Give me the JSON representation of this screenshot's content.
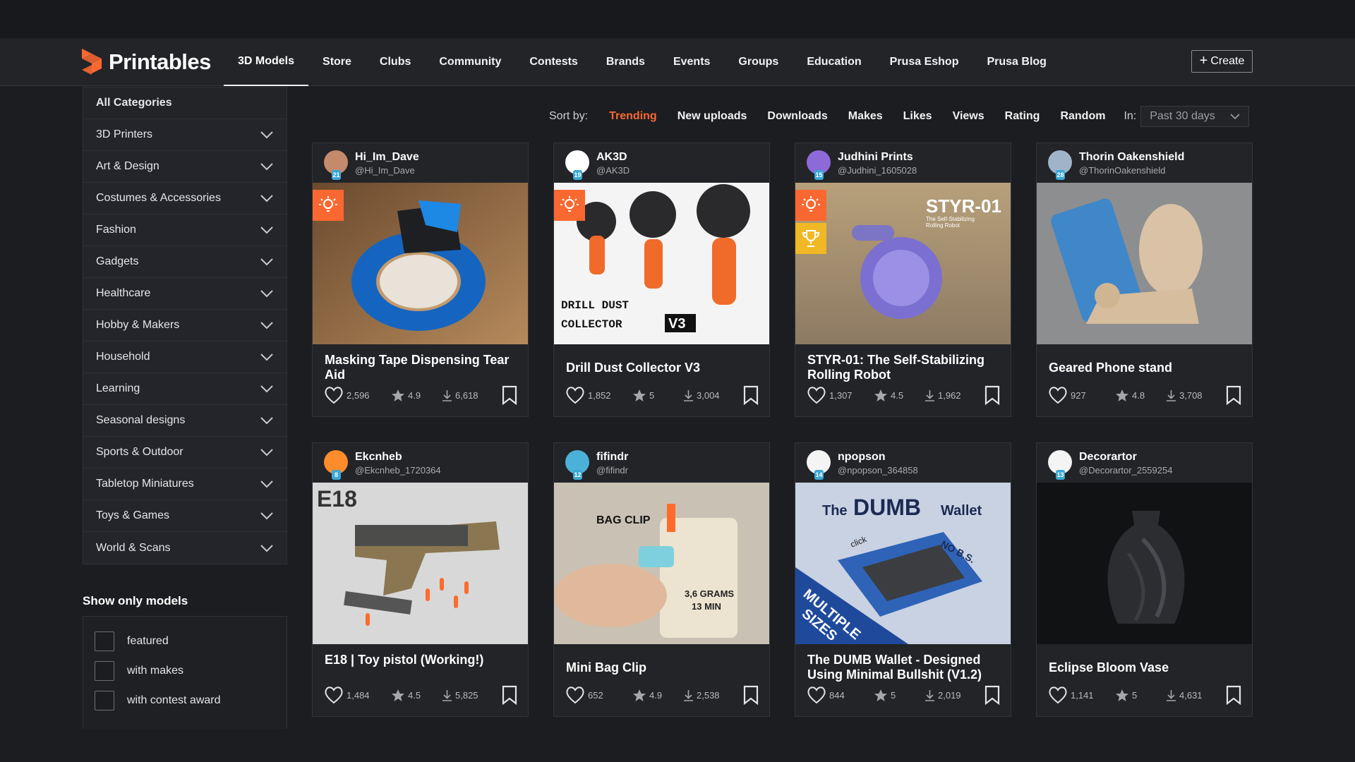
{
  "brand": {
    "name": "Printables",
    "accent": "#fa6831"
  },
  "nav": [
    {
      "label": "3D Models",
      "active": true
    },
    {
      "label": "Store"
    },
    {
      "label": "Clubs"
    },
    {
      "label": "Community"
    },
    {
      "label": "Contests"
    },
    {
      "label": "Brands"
    },
    {
      "label": "Events"
    },
    {
      "label": "Groups"
    },
    {
      "label": "Education"
    },
    {
      "label": "Prusa Eshop"
    },
    {
      "label": "Prusa Blog"
    }
  ],
  "create_label": "Create",
  "sidebar": {
    "all_label": "All Categories",
    "categories": [
      "3D Printers",
      "Art & Design",
      "Costumes & Accessories",
      "Fashion",
      "Gadgets",
      "Healthcare",
      "Hobby & Makers",
      "Household",
      "Learning",
      "Seasonal designs",
      "Sports & Outdoor",
      "Tabletop Miniatures",
      "Toys & Games",
      "World & Scans"
    ],
    "show_only_title": "Show only models",
    "filters": [
      "featured",
      "with makes",
      "with contest award"
    ]
  },
  "sort": {
    "label": "Sort by:",
    "options": [
      "Trending",
      "New uploads",
      "Downloads",
      "Makes",
      "Likes",
      "Views",
      "Rating",
      "Random"
    ],
    "active": "Trending",
    "in_label": "In:",
    "period": "Past 30 days"
  },
  "models": [
    {
      "user": "Hi_Im_Dave",
      "handle": "@Hi_Im_Dave",
      "level": "21",
      "title": "Masking Tape Dispensing Tear Aid",
      "likes": "2,596",
      "rating": "4.9",
      "downloads": "6,618",
      "badges": [
        "idea-icon"
      ]
    },
    {
      "user": "AK3D",
      "handle": "@AK3D",
      "level": "19",
      "title": "Drill Dust Collector V3",
      "likes": "1,852",
      "rating": "5",
      "downloads": "3,004",
      "badges": [
        "idea-icon"
      ],
      "overlay": {
        "line1": "DRILL DUST",
        "line2": "COLLECTOR",
        "version": "V3"
      }
    },
    {
      "user": "Judhini Prints",
      "handle": "@Judhini_1605028",
      "level": "15",
      "title": "STYR-01: The Self-Stabilizing Rolling Robot",
      "likes": "1,307",
      "rating": "4.5",
      "downloads": "1,962",
      "badges": [
        "idea-icon",
        "trophy-icon"
      ],
      "overlay": {
        "line1": "STYR-01",
        "line2": "The Self-Stabilizing",
        "line3": "Rolling Robot"
      }
    },
    {
      "user": "Thorin Oakenshield",
      "handle": "@ThorinOakenshield",
      "level": "28",
      "title": "Geared Phone stand",
      "likes": "927",
      "rating": "4.8",
      "downloads": "3,708",
      "badges": []
    },
    {
      "user": "Ekcnheb",
      "handle": "@Ekcnheb_1720364",
      "level": "8",
      "title": "E18 | Toy pistol (Working!)",
      "likes": "1,484",
      "rating": "4.5",
      "downloads": "5,825",
      "badges": [],
      "overlay": {
        "line1": "E18"
      }
    },
    {
      "user": "fifindr",
      "handle": "@fifindr",
      "level": "12",
      "title": "Mini Bag Clip",
      "likes": "652",
      "rating": "4.9",
      "downloads": "2,538",
      "badges": [],
      "overlay": {
        "line1": "BAG CLIP",
        "line2": "3,6 GRAMS",
        "line3": "13 MIN"
      }
    },
    {
      "user": "npopson",
      "handle": "@npopson_364858",
      "level": "14",
      "title": "The DUMB Wallet - Designed Using Minimal Bullshit (V1.2)",
      "likes": "844",
      "rating": "5",
      "downloads": "2,019",
      "badges": [],
      "overlay": {
        "line1": "The",
        "line2": "DUMB",
        "line3": "Wallet",
        "line4": "click",
        "line5": "NO B.S.",
        "line6": "MULTIPLE",
        "line7": "SIZES"
      }
    },
    {
      "user": "Decorartor",
      "handle": "@Decorartor_2559254",
      "level": "13",
      "title": "Eclipse Bloom Vase",
      "likes": "1,141",
      "rating": "5",
      "downloads": "4,631",
      "badges": []
    }
  ]
}
